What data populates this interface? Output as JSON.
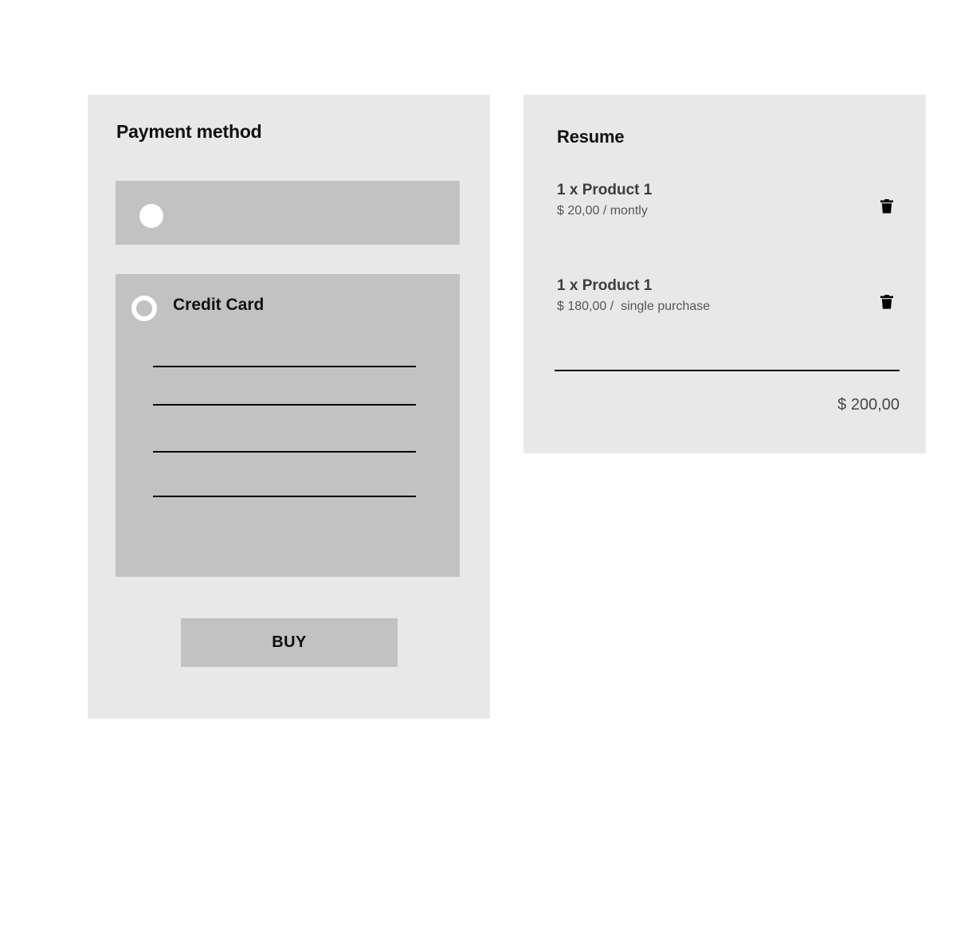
{
  "page": {
    "background": "#ffffff",
    "panel_background": "#e9e8e8",
    "block_background": "#c2c2c2",
    "accent_text": "#111111"
  },
  "payment": {
    "title": "Payment method",
    "options": [
      {
        "label": "",
        "radio_icon": "radio-filled-icon",
        "selected": false
      },
      {
        "label": "Credit Card",
        "radio_icon": "radio-ring-icon",
        "selected": true
      }
    ],
    "credit_card_fields": [
      {
        "name": "card-number",
        "value": "",
        "placeholder": ""
      },
      {
        "name": "card-holder",
        "value": "",
        "placeholder": ""
      },
      {
        "name": "card-expiry",
        "value": "",
        "placeholder": ""
      },
      {
        "name": "card-cvv",
        "value": "",
        "placeholder": ""
      }
    ],
    "buy_label": "BUY"
  },
  "resume": {
    "title": "Resume",
    "items": [
      {
        "name": "1 x Product 1",
        "price": "$ 20,00 / montly",
        "delete_icon": "trash-icon"
      },
      {
        "name": "1 x Product 1",
        "price": "$ 180,00 /  single purchase",
        "delete_icon": "trash-icon"
      }
    ],
    "total": "$ 200,00"
  }
}
